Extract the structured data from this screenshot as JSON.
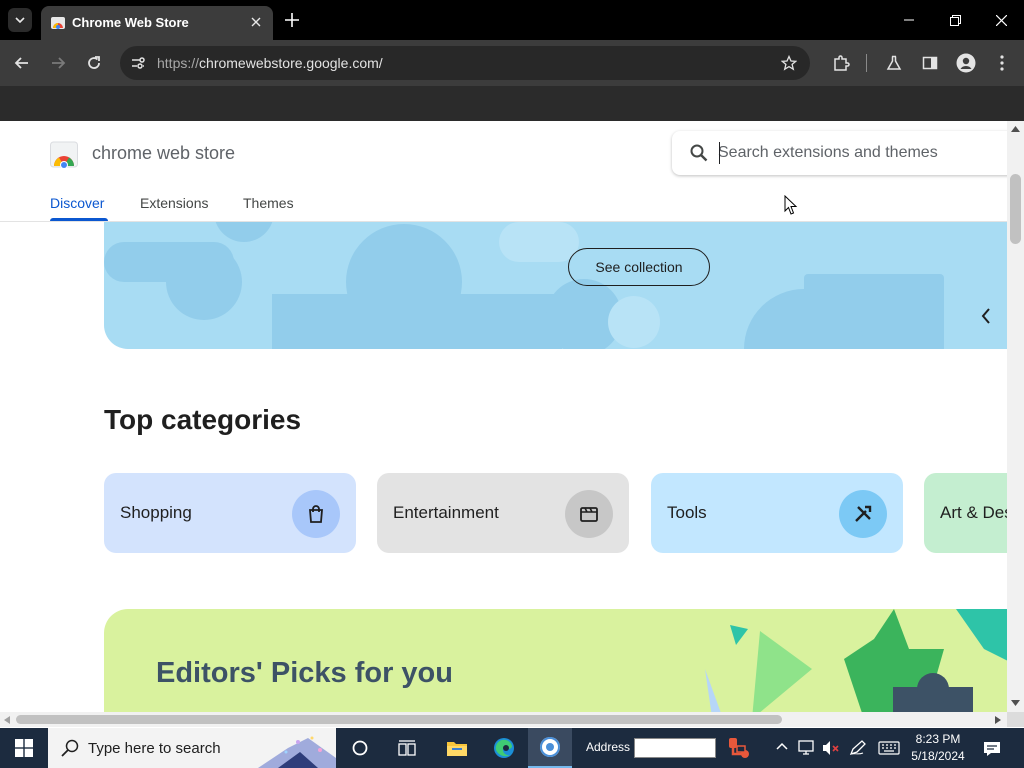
{
  "browser": {
    "tab_title": "Chrome Web Store",
    "url_scheme": "https://",
    "url_host": "chromewebstore.google.com/"
  },
  "store": {
    "logo_text": "chrome web store",
    "search_placeholder": "Search extensions and themes",
    "nav": [
      {
        "label": "Discover",
        "active": true
      },
      {
        "label": "Extensions",
        "active": false
      },
      {
        "label": "Themes",
        "active": false
      }
    ]
  },
  "hero": {
    "button_label": "See collection",
    "color": "#a8dcf3"
  },
  "categories": {
    "title": "Top categories",
    "items": [
      {
        "label": "Shopping",
        "icon": "shopping-bag-icon",
        "bg": "#d3e3fd",
        "icon_bg": "#a8c7fa"
      },
      {
        "label": "Entertainment",
        "icon": "movie-icon",
        "bg": "#e3e3e3",
        "icon_bg": "#c7c7c7"
      },
      {
        "label": "Tools",
        "icon": "tools-icon",
        "bg": "#c2e7ff",
        "icon_bg": "#7cc9f5"
      },
      {
        "label": "Art & Design",
        "icon": "palette-icon",
        "bg": "#c4eed0",
        "icon_bg": "#a0e0b4"
      }
    ]
  },
  "picks": {
    "title": "Editors' Picks for you",
    "color": "#d9f29e"
  },
  "taskbar": {
    "search_placeholder": "Type here to search",
    "address_label": "Address",
    "time": "8:23 PM",
    "date": "5/18/2024"
  }
}
